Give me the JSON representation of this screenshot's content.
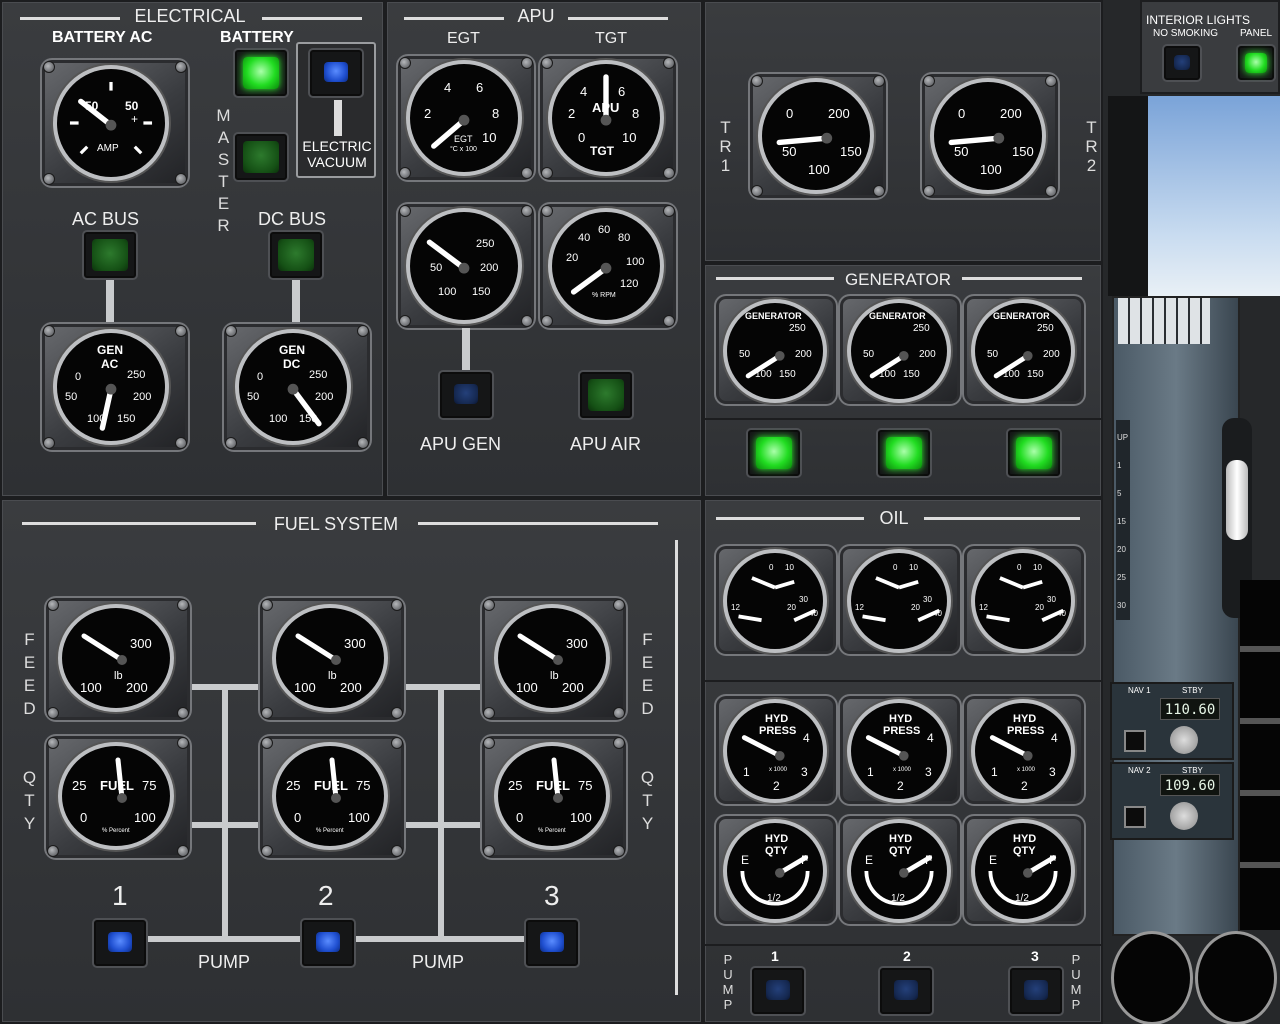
{
  "electrical": {
    "title": "ELECTRICAL",
    "battery_ac": "BATTERY AC",
    "battery": "BATTERY",
    "master": "MASTER",
    "electric_vacuum_line1": "ELECTRIC",
    "electric_vacuum_line2": "VACUUM",
    "ac_bus": "AC BUS",
    "dc_bus": "DC BUS",
    "amp_gauge": {
      "top_left": "50",
      "top_right": "50",
      "plus": "+",
      "unit": "AMP"
    },
    "gen_ac": {
      "line1": "GEN",
      "line2": "AC",
      "scale": [
        "0",
        "50",
        "100",
        "150",
        "200",
        "250"
      ]
    },
    "gen_dc": {
      "line1": "GEN",
      "line2": "DC",
      "scale": [
        "0",
        "50",
        "100",
        "150",
        "200",
        "250"
      ]
    }
  },
  "apu": {
    "title": "APU",
    "egt": "EGT",
    "tgt": "TGT",
    "egt_scale": [
      "2",
      "4",
      "6",
      "8",
      "10"
    ],
    "egt_unit": "EGT",
    "egt_subunit": "°C x 100",
    "tgt_scale": [
      "0",
      "2",
      "4",
      "6",
      "8",
      "10"
    ],
    "tgt_label1": "APU",
    "tgt_label2": "TGT",
    "load_scale": [
      "50",
      "100",
      "150",
      "200",
      "250"
    ],
    "rpm_scale": [
      "20",
      "40",
      "60",
      "80",
      "100",
      "120"
    ],
    "rpm_unit": "% RPM",
    "apu_gen": "APU GEN",
    "apu_air": "APU AIR"
  },
  "tr": {
    "tr1": "TR1",
    "tr2": "TR2",
    "scale": [
      "0",
      "50",
      "100",
      "150",
      "200"
    ]
  },
  "generator": {
    "title": "GENERATOR",
    "gauge_label": "GENERATOR",
    "scale": [
      "50",
      "100",
      "150",
      "200",
      "250"
    ]
  },
  "fuel": {
    "title": "FUEL SYSTEM",
    "feed": "FEED",
    "qty": "QTY",
    "feed_scale": [
      "100",
      "200",
      "300"
    ],
    "feed_unit": "lb",
    "qty_scale": [
      "0",
      "25",
      "75",
      "100"
    ],
    "qty_label": "FUEL",
    "qty_unit": "% Percent",
    "pumps": [
      "1",
      "2",
      "3"
    ],
    "pump_label": "PUMP"
  },
  "oil": {
    "title": "OIL",
    "scale_a": [
      "0",
      "10",
      "12",
      "20",
      "30",
      "40"
    ]
  },
  "hyd": {
    "press_line1": "HYD",
    "press_line2": "PRESS",
    "press_scale": [
      "1",
      "2",
      "3",
      "4"
    ],
    "press_unit": "x 1000",
    "qty_line1": "HYD",
    "qty_line2": "QTY",
    "qty_e": "E",
    "qty_f": "F",
    "qty_half": "1/2",
    "pump_word": "PUMP",
    "pumps": [
      "1",
      "2",
      "3"
    ]
  },
  "overhead": {
    "interior_lights": "INTERIOR LIGHTS",
    "no_smoking": "NO SMOKING",
    "panel": "PANEL"
  },
  "radio": {
    "nav1": "NAV 1",
    "nav2": "NAV 2",
    "stby": "STBY",
    "nav1_stby": "110.60",
    "nav2_stby": "109.60"
  },
  "flaps": [
    "UP",
    "1",
    "5",
    "15",
    "20",
    "25",
    "30"
  ]
}
